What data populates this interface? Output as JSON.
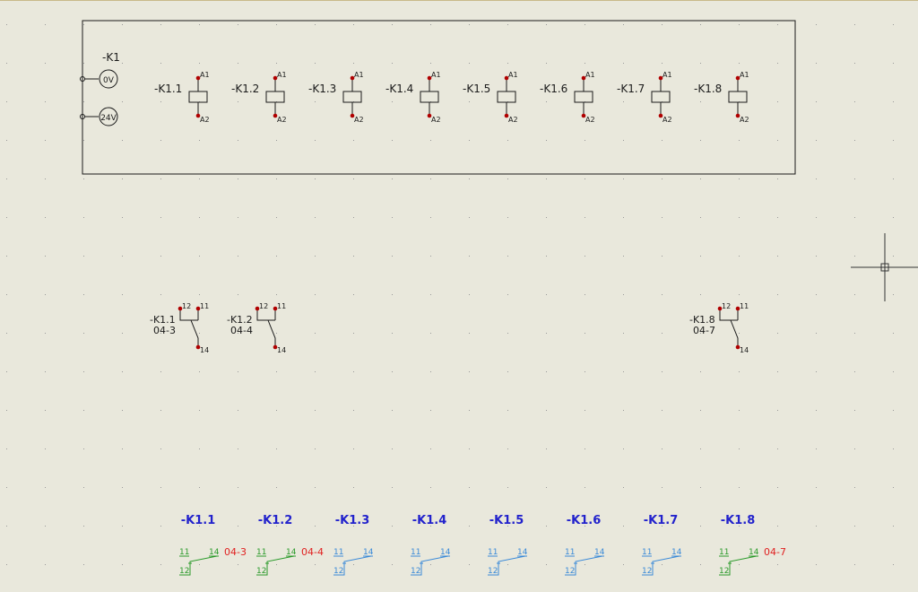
{
  "master": {
    "tag": "-K1",
    "terminals": [
      "0V",
      "24V"
    ]
  },
  "coils": [
    {
      "tag": "-K1.1",
      "pin_top": "A1",
      "pin_bottom": "A2"
    },
    {
      "tag": "-K1.2",
      "pin_top": "A1",
      "pin_bottom": "A2"
    },
    {
      "tag": "-K1.3",
      "pin_top": "A1",
      "pin_bottom": "A2"
    },
    {
      "tag": "-K1.4",
      "pin_top": "A1",
      "pin_bottom": "A2"
    },
    {
      "tag": "-K1.5",
      "pin_top": "A1",
      "pin_bottom": "A2"
    },
    {
      "tag": "-K1.6",
      "pin_top": "A1",
      "pin_bottom": "A2"
    },
    {
      "tag": "-K1.7",
      "pin_top": "A1",
      "pin_bottom": "A2"
    },
    {
      "tag": "-K1.8",
      "pin_top": "A1",
      "pin_bottom": "A2"
    }
  ],
  "contacts": [
    {
      "coil_index": 0,
      "tag": "-K1.1",
      "ref": "04-3",
      "pins": [
        "12",
        "11",
        "14"
      ]
    },
    {
      "coil_index": 1,
      "tag": "-K1.2",
      "ref": "04-4",
      "pins": [
        "12",
        "11",
        "14"
      ]
    },
    {
      "coil_index": 7,
      "tag": "-K1.8",
      "ref": "04-7",
      "pins": [
        "12",
        "11",
        "14"
      ]
    }
  ],
  "cross_refs": [
    {
      "tag": "-K1.1",
      "pins": [
        "11",
        "14",
        "12"
      ],
      "ref": "04-3",
      "used": true
    },
    {
      "tag": "-K1.2",
      "pins": [
        "11",
        "14",
        "12"
      ],
      "ref": "04-4",
      "used": true
    },
    {
      "tag": "-K1.3",
      "pins": [
        "11",
        "14",
        "12"
      ],
      "ref": "",
      "used": false
    },
    {
      "tag": "-K1.4",
      "pins": [
        "11",
        "14",
        "12"
      ],
      "ref": "",
      "used": false
    },
    {
      "tag": "-K1.5",
      "pins": [
        "11",
        "14",
        "12"
      ],
      "ref": "",
      "used": false
    },
    {
      "tag": "-K1.6",
      "pins": [
        "11",
        "14",
        "12"
      ],
      "ref": "",
      "used": false
    },
    {
      "tag": "-K1.7",
      "pins": [
        "11",
        "14",
        "12"
      ],
      "ref": "",
      "used": false
    },
    {
      "tag": "-K1.8",
      "pins": [
        "11",
        "14",
        "12"
      ],
      "ref": "04-7",
      "used": true
    }
  ],
  "colors": {
    "background": "#e9e8dc",
    "line": "#1a1a1a",
    "pin": "#b00000",
    "tag_blue": "#2222cc",
    "used": "#2a9a2a",
    "unused": "#3a8ad8",
    "ref_red": "#e02020",
    "grid": "#9a9a9a"
  }
}
